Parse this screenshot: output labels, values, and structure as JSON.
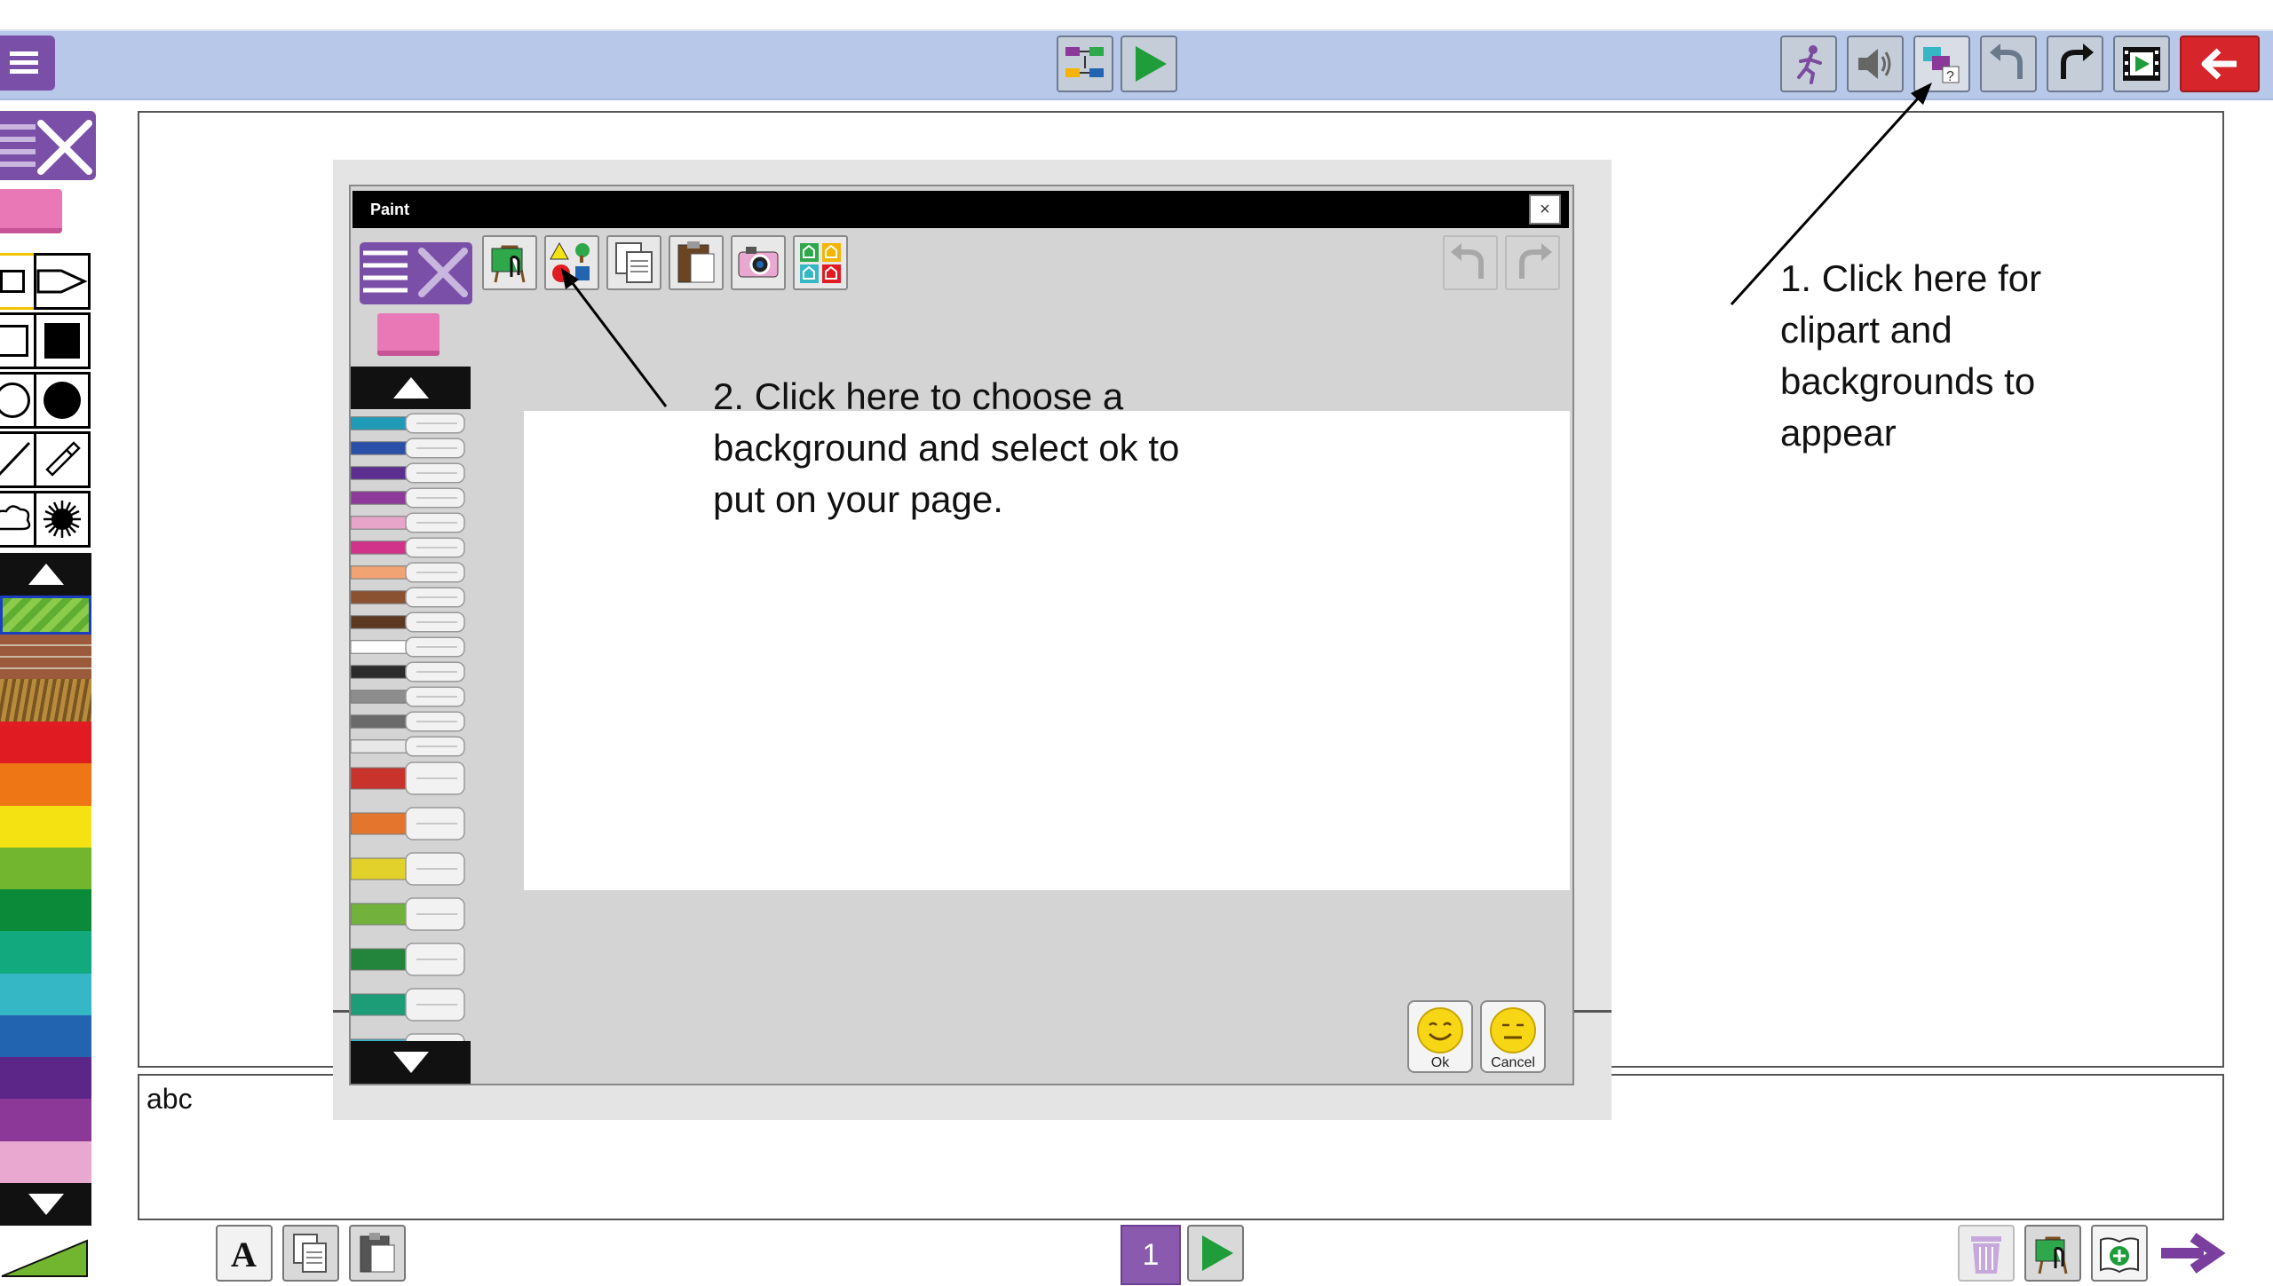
{
  "topbar": {
    "menu_icon": "hamburger-menu-icon",
    "center_buttons": [
      "storyboard-icon",
      "play-icon"
    ],
    "right_buttons": [
      "animation-person-icon",
      "speaker-icon",
      "clipart-backgrounds-icon",
      "undo-icon",
      "redo-icon",
      "film-icon",
      "back-arrow-icon"
    ]
  },
  "left_palette": {
    "tools": [
      "rectangle-outline",
      "arrow-marker",
      "square-outline",
      "square-filled",
      "circle-outline",
      "circle-filled",
      "line",
      "eyedropper",
      "cloud-shape",
      "splat-shape"
    ],
    "colors": [
      "#e01b22",
      "#ee7614",
      "#f5e212",
      "#72b62f",
      "#0b8a3a",
      "#12a97e",
      "#35b7c6",
      "#2364b1",
      "#5b2687",
      "#8c3898",
      "#e8a8cf"
    ]
  },
  "main_text": "abc",
  "paint_dialog": {
    "title": "Paint",
    "close": "×",
    "toolbar_icons": [
      "paint-canvas-icon",
      "shapes-backgrounds-icon",
      "copy-icon",
      "paste-icon",
      "camera-icon",
      "houses-icon"
    ],
    "markers": [
      "#1f9bb7",
      "#2a4fa8",
      "#5b2e8f",
      "#8d3a9b",
      "#e6a5c9",
      "#d1338a",
      "#f1a373",
      "#8a5230",
      "#5c3a22",
      "#ffffff",
      "#2b2b2b",
      "#8d8d8d",
      "#6a6a6a",
      "#e8e8e8",
      "#c8342c",
      "#e4752d",
      "#e3d12b",
      "#72b23c",
      "#23853b",
      "#1c9c77",
      "#3bb6c8"
    ],
    "ok_label": "Ok",
    "cancel_label": "Cancel"
  },
  "annotations": {
    "note1": [
      "1. Click here for",
      "clipart and",
      "backgrounds to",
      "appear"
    ],
    "note2": [
      "2. Click here to choose a",
      "background and select ok to",
      "put on your page."
    ]
  },
  "bottombar": {
    "left_buttons": [
      "text-icon",
      "copy-icon",
      "paste-icon"
    ],
    "page_number": "1",
    "right_buttons": [
      "trash-icon",
      "paint-canvas-icon",
      "add-page-icon",
      "next-arrow-icon"
    ]
  }
}
